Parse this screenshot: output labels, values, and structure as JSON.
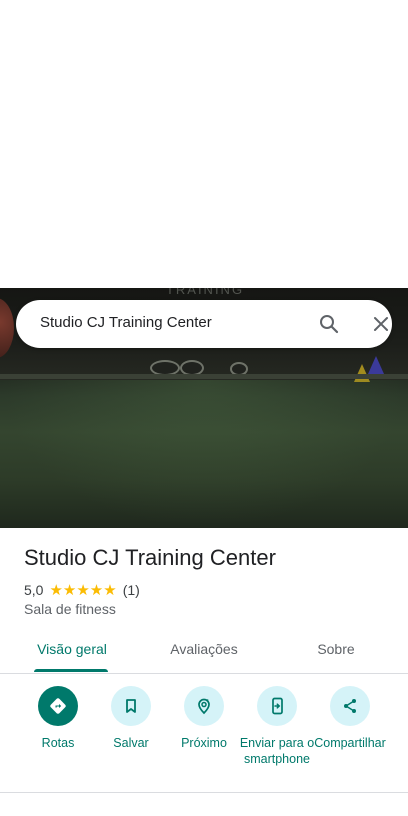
{
  "search": {
    "query": "Studio CJ Training Center"
  },
  "hero": {
    "sign_text": "TRAINING CENTER"
  },
  "place": {
    "name": "Studio CJ Training Center",
    "rating": "5,0",
    "stars": "★★★★★",
    "review_count": "(1)",
    "category": "Sala de fitness"
  },
  "tabs": [
    {
      "label": "Visão geral",
      "active": true
    },
    {
      "label": "Avaliações",
      "active": false
    },
    {
      "label": "Sobre",
      "active": false
    }
  ],
  "actions": [
    {
      "label": "Rotas",
      "icon": "directions-icon"
    },
    {
      "label": "Salvar",
      "icon": "bookmark-icon"
    },
    {
      "label": "Próximo",
      "icon": "nearby-icon"
    },
    {
      "label": "Enviar para o smartphone",
      "icon": "send-to-phone-icon"
    },
    {
      "label": "Compartilhar",
      "icon": "share-icon"
    }
  ],
  "colors": {
    "accent": "#00796b",
    "action_bg": "#d5f3f8",
    "star": "#fbbc04"
  }
}
